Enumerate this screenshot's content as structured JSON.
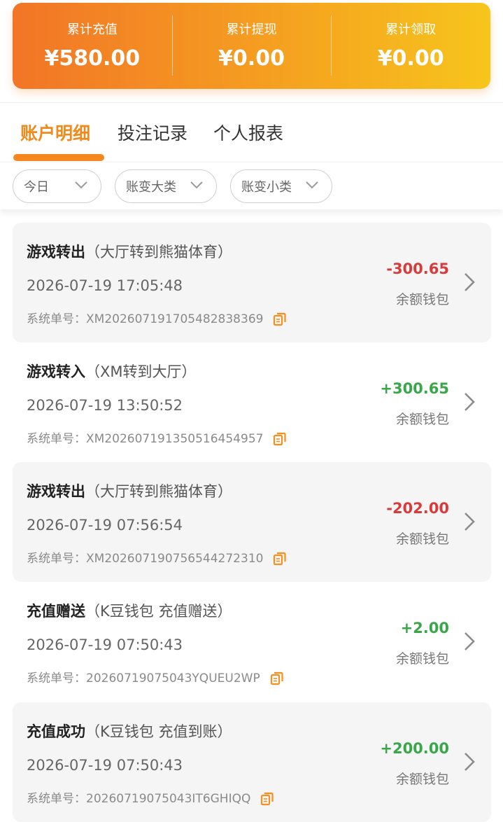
{
  "summary": {
    "items": [
      {
        "label": "累计充值",
        "value": "¥580.00"
      },
      {
        "label": "累计提现",
        "value": "¥0.00"
      },
      {
        "label": "累计领取",
        "value": "¥0.00"
      }
    ],
    "gradient": [
      "#f27527",
      "#f7c51c"
    ]
  },
  "tabs": [
    {
      "label": "账户明细",
      "active": true
    },
    {
      "label": "投注记录",
      "active": false
    },
    {
      "label": "个人报表",
      "active": false
    }
  ],
  "filters": [
    {
      "label": "今日",
      "icon": "chevron-down-icon"
    },
    {
      "label": "账变大类",
      "icon": "chevron-down-icon"
    },
    {
      "label": "账变小类",
      "icon": "chevron-down-icon"
    }
  ],
  "records": [
    {
      "title": "游戏转出",
      "subtitle": "（大厅转到熊猫体育）",
      "time": "2026-07-19 17:05:48",
      "order_label": "系统单号：",
      "order_no": "XM202607191705482838369",
      "amount": "-300.65",
      "sign": "neg",
      "wallet": "余额钱包"
    },
    {
      "title": "游戏转入",
      "subtitle": "（XM转到大厅）",
      "time": "2026-07-19 13:50:52",
      "order_label": "系统单号：",
      "order_no": "XM202607191350516454957",
      "amount": "+300.65",
      "sign": "pos",
      "wallet": "余额钱包"
    },
    {
      "title": "游戏转出",
      "subtitle": "（大厅转到熊猫体育）",
      "time": "2026-07-19 07:56:54",
      "order_label": "系统单号：",
      "order_no": "XM202607190756544272310",
      "amount": "-202.00",
      "sign": "neg",
      "wallet": "余额钱包"
    },
    {
      "title": "充值赠送",
      "subtitle": "（K豆钱包 充值赠送）",
      "time": "2026-07-19 07:50:43",
      "order_label": "系统单号：",
      "order_no": "20260719075043YQUEU2WP",
      "amount": "+2.00",
      "sign": "pos",
      "wallet": "余额钱包"
    },
    {
      "title": "充值成功",
      "subtitle": "（K豆钱包 充值到账）",
      "time": "2026-07-19 07:50:43",
      "order_label": "系统单号：",
      "order_no": "20260719075043IT6GHIQQ",
      "amount": "+200.00",
      "sign": "pos",
      "wallet": "余额钱包"
    }
  ],
  "colors": {
    "accent": "#f08a1c",
    "negative": "#d93b3b",
    "positive": "#3aa64a"
  }
}
